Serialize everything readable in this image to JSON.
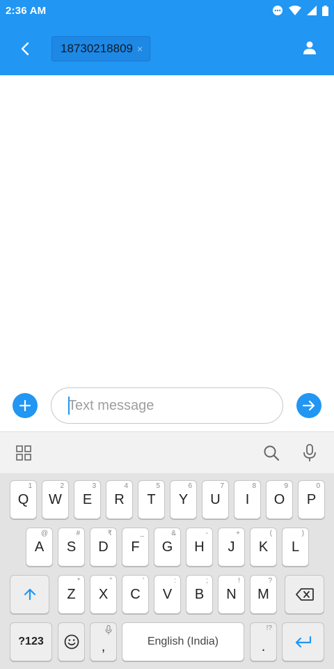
{
  "status_bar": {
    "time": "2:36 AM",
    "icons": [
      "notification-dots-icon",
      "wifi-icon",
      "signal-icon",
      "battery-icon"
    ]
  },
  "app_bar": {
    "recipient": "18730218809",
    "chip_close": "×",
    "back_icon": "back-arrow-icon",
    "contact_icon": "person-icon"
  },
  "compose": {
    "placeholder": "Text message",
    "value": ""
  },
  "keyboard": {
    "rows": [
      [
        {
          "main": "Q",
          "hint": "1"
        },
        {
          "main": "W",
          "hint": "2"
        },
        {
          "main": "E",
          "hint": "3"
        },
        {
          "main": "R",
          "hint": "4"
        },
        {
          "main": "T",
          "hint": "5"
        },
        {
          "main": "Y",
          "hint": "6"
        },
        {
          "main": "U",
          "hint": "7"
        },
        {
          "main": "I",
          "hint": "8"
        },
        {
          "main": "O",
          "hint": "9"
        },
        {
          "main": "P",
          "hint": "0"
        }
      ],
      [
        {
          "main": "A",
          "hint": "@"
        },
        {
          "main": "S",
          "hint": "#"
        },
        {
          "main": "D",
          "hint": "₹"
        },
        {
          "main": "F",
          "hint": "_"
        },
        {
          "main": "G",
          "hint": "&"
        },
        {
          "main": "H",
          "hint": "-"
        },
        {
          "main": "J",
          "hint": "+"
        },
        {
          "main": "K",
          "hint": "("
        },
        {
          "main": "L",
          "hint": ")"
        }
      ],
      [
        {
          "main": "Z",
          "hint": "*"
        },
        {
          "main": "X",
          "hint": "\""
        },
        {
          "main": "C",
          "hint": "'"
        },
        {
          "main": "V",
          "hint": ":"
        },
        {
          "main": "B",
          "hint": ";"
        },
        {
          "main": "N",
          "hint": "!"
        },
        {
          "main": "M",
          "hint": "?"
        }
      ]
    ],
    "symbols_label": "?123",
    "comma_label": ",",
    "space_label": "English (India)",
    "period_label": ".",
    "period_hint": "!?"
  },
  "colors": {
    "accent": "#2196f3"
  }
}
